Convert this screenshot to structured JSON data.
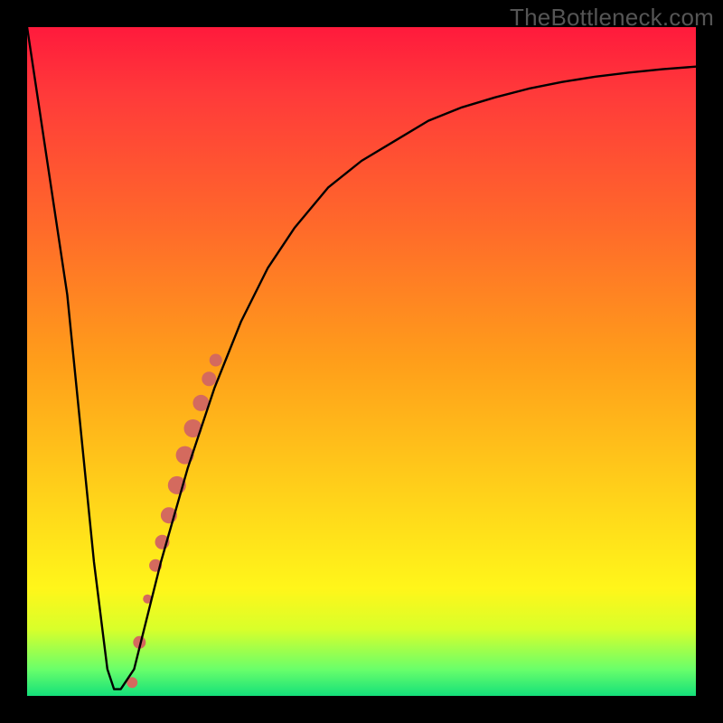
{
  "watermark": "TheBottleneck.com",
  "chart_data": {
    "type": "line",
    "title": "",
    "xlabel": "",
    "ylabel": "",
    "xlim": [
      0,
      100
    ],
    "ylim": [
      0,
      100
    ],
    "series": [
      {
        "name": "bottleneck-curve",
        "x": [
          0,
          6,
          10,
          12,
          13,
          14,
          16,
          20,
          24,
          28,
          32,
          36,
          40,
          45,
          50,
          55,
          60,
          65,
          70,
          75,
          80,
          85,
          90,
          95,
          100
        ],
        "y": [
          100,
          60,
          20,
          4,
          1,
          1,
          4,
          20,
          34,
          46,
          56,
          64,
          70,
          76,
          80,
          83,
          86,
          88,
          89.5,
          90.8,
          91.8,
          92.6,
          93.2,
          93.7,
          94.1
        ]
      }
    ],
    "markers": {
      "name": "highlighted-range",
      "color": "#d46a5e",
      "points": [
        {
          "x": 15.7,
          "y": 2.0,
          "r": 6
        },
        {
          "x": 16.8,
          "y": 8.0,
          "r": 7
        },
        {
          "x": 18.0,
          "y": 14.5,
          "r": 5
        },
        {
          "x": 19.2,
          "y": 19.5,
          "r": 7
        },
        {
          "x": 20.2,
          "y": 23.0,
          "r": 8
        },
        {
          "x": 21.2,
          "y": 27.0,
          "r": 9
        },
        {
          "x": 22.4,
          "y": 31.5,
          "r": 10
        },
        {
          "x": 23.6,
          "y": 36.0,
          "r": 10
        },
        {
          "x": 24.8,
          "y": 40.0,
          "r": 10
        },
        {
          "x": 26.0,
          "y": 43.8,
          "r": 9
        },
        {
          "x": 27.2,
          "y": 47.4,
          "r": 8
        },
        {
          "x": 28.2,
          "y": 50.2,
          "r": 7
        }
      ]
    },
    "gradient_stops": [
      {
        "pos": 0,
        "color": "#ff1a3c"
      },
      {
        "pos": 10,
        "color": "#ff3a3a"
      },
      {
        "pos": 30,
        "color": "#ff6a2a"
      },
      {
        "pos": 50,
        "color": "#ff9e1a"
      },
      {
        "pos": 70,
        "color": "#ffd21a"
      },
      {
        "pos": 84,
        "color": "#fff61a"
      },
      {
        "pos": 90,
        "color": "#d9ff2a"
      },
      {
        "pos": 96,
        "color": "#6aff6a"
      },
      {
        "pos": 100,
        "color": "#14e07a"
      }
    ]
  }
}
